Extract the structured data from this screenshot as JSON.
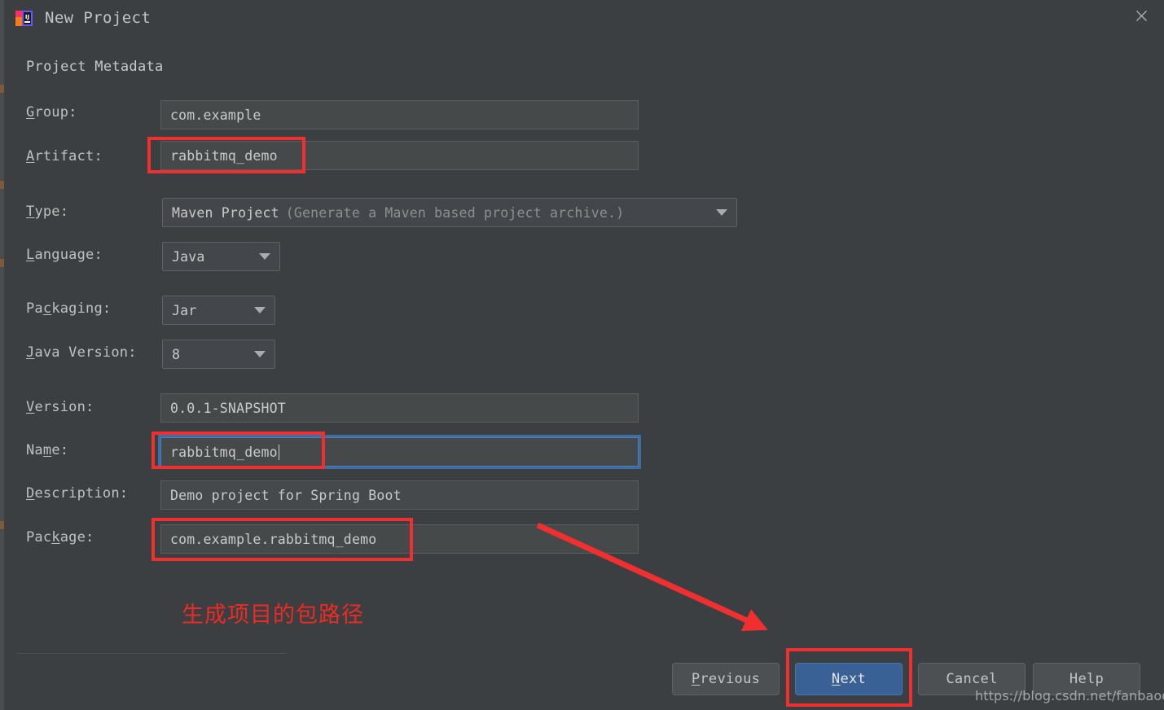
{
  "window": {
    "title": "New Project",
    "app_icon": "intellij-idea-icon",
    "close_icon": "close-icon"
  },
  "section": {
    "heading": "Project Metadata"
  },
  "fields": {
    "group": {
      "label_prefix": "",
      "label_mnemonic": "G",
      "label_suffix": "roup:",
      "value": "com.example"
    },
    "artifact": {
      "label_prefix": "",
      "label_mnemonic": "A",
      "label_suffix": "rtifact:",
      "value": "rabbitmq_demo"
    },
    "type": {
      "label_prefix": "",
      "label_mnemonic": "T",
      "label_suffix": "ype:",
      "value": "Maven Project",
      "hint": "(Generate a Maven based project archive.)"
    },
    "language": {
      "label_prefix": "",
      "label_mnemonic": "L",
      "label_suffix": "anguage:",
      "value": "Java"
    },
    "packaging": {
      "label_prefix": "Pa",
      "label_mnemonic": "c",
      "label_suffix": "kaging:",
      "value": "Jar"
    },
    "java_version": {
      "label_prefix": "",
      "label_mnemonic": "J",
      "label_suffix": "ava Version:",
      "value": "8"
    },
    "version": {
      "label_prefix": "",
      "label_mnemonic": "V",
      "label_suffix": "ersion:",
      "value": "0.0.1-SNAPSHOT"
    },
    "name": {
      "label_prefix": "Na",
      "label_mnemonic": "m",
      "label_suffix": "e:",
      "value": "rabbitmq_demo"
    },
    "description": {
      "label_prefix": "",
      "label_mnemonic": "D",
      "label_suffix": "escription:",
      "value": "Demo project for Spring Boot"
    },
    "package": {
      "label_prefix": "Pac",
      "label_mnemonic": "k",
      "label_suffix": "age:",
      "value": "com.example.rabbitmq_demo"
    }
  },
  "annotations": {
    "note_text": "生成项目的包路径",
    "highlight_color": "#f03030",
    "arrow_color": "#f03030"
  },
  "buttons": {
    "previous": {
      "prefix": "",
      "mnemonic": "P",
      "suffix": "revious"
    },
    "next": {
      "prefix": "",
      "mnemonic": "N",
      "suffix": "ext"
    },
    "cancel": {
      "prefix": "Cancel",
      "mnemonic": "",
      "suffix": ""
    },
    "help": {
      "prefix": "Help",
      "mnemonic": "",
      "suffix": ""
    }
  },
  "watermark": {
    "text": "https://blog.csdn.net/fanbaodan"
  }
}
